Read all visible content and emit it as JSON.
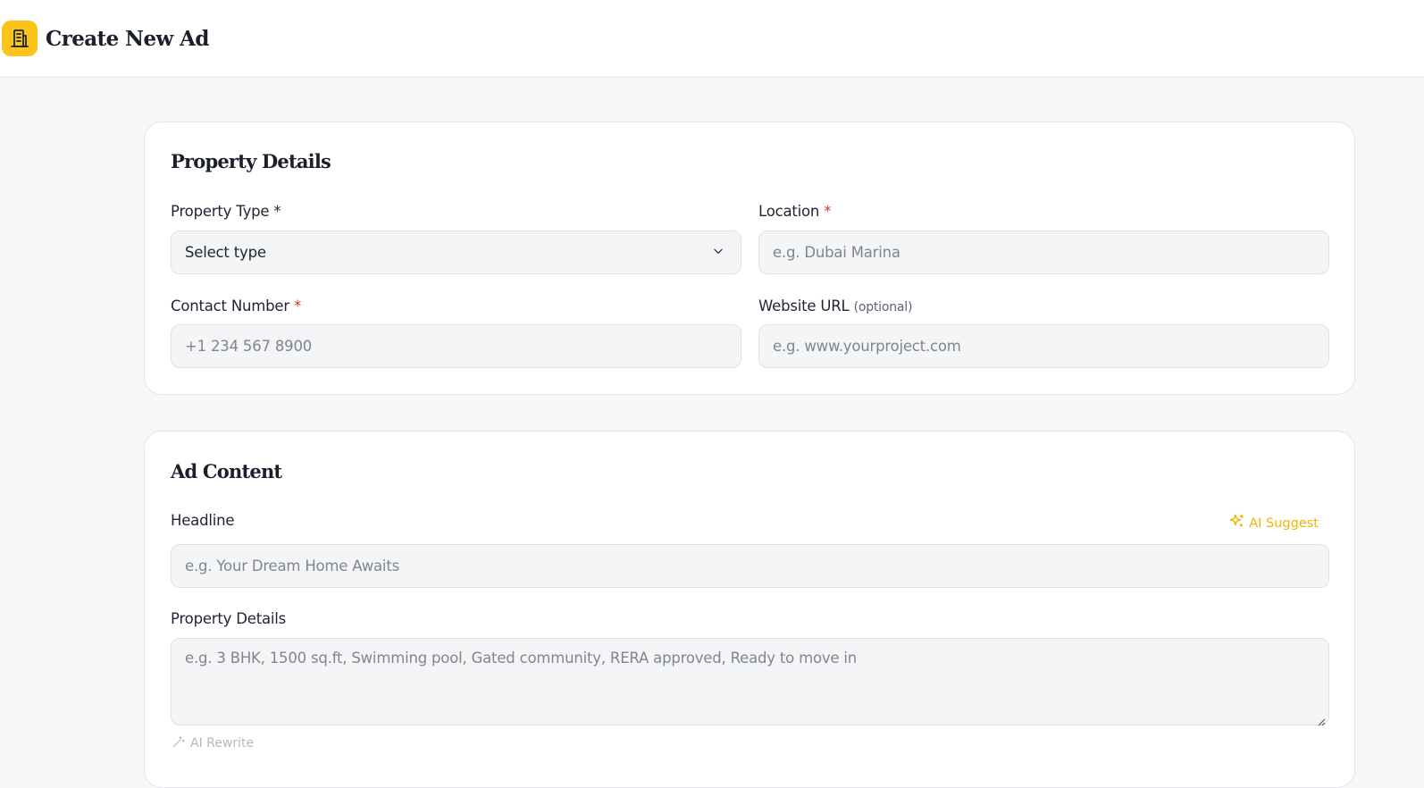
{
  "header": {
    "logo_icon": "building-icon",
    "title": "Create New Ad"
  },
  "property_details": {
    "title": "Property Details",
    "property_type": {
      "label": "Property Type *",
      "selected": "Select type"
    },
    "location": {
      "label": "Location",
      "required_mark": "*",
      "placeholder": "e.g. Dubai Marina"
    },
    "contact": {
      "label": "Contact Number",
      "required_mark": "*",
      "placeholder": "+1 234 567 8900"
    },
    "website": {
      "label": "Website URL",
      "optional": "(optional)",
      "placeholder": "e.g. www.yourproject.com"
    }
  },
  "ad_content": {
    "title": "Ad Content",
    "headline": {
      "label": "Headline",
      "placeholder": "e.g. Your Dream Home Awaits"
    },
    "ai_suggest": "AI Suggest",
    "details": {
      "label": "Property Details",
      "placeholder": "e.g. 3 BHK, 1500 sq.ft, Swimming pool, Gated community, RERA approved, Ready to move in"
    },
    "ai_rewrite": "AI Rewrite"
  },
  "colors": {
    "accent": "#fcc419",
    "ai_suggest": "#f0b400",
    "required": "#e03131",
    "background": "#f6f7f8"
  }
}
